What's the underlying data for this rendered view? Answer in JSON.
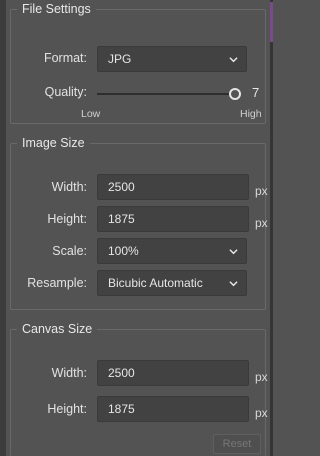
{
  "file_settings": {
    "legend": "File Settings",
    "format_label": "Format:",
    "format_value": "JPG",
    "quality_label": "Quality:",
    "quality_value": "7",
    "quality_fraction": 1.0,
    "low_label": "Low",
    "high_label": "High"
  },
  "image_size": {
    "legend": "Image Size",
    "width_label": "Width:",
    "width_value": "2500",
    "height_label": "Height:",
    "height_value": "1875",
    "scale_label": "Scale:",
    "scale_value": "100%",
    "resample_label": "Resample:",
    "resample_value": "Bicubic Automatic",
    "unit": "px"
  },
  "canvas_size": {
    "legend": "Canvas Size",
    "width_label": "Width:",
    "width_value": "2500",
    "height_label": "Height:",
    "height_value": "1875",
    "unit": "px",
    "reset_label": "Reset"
  },
  "icons": {
    "dropdown": "chevron-down-icon"
  }
}
